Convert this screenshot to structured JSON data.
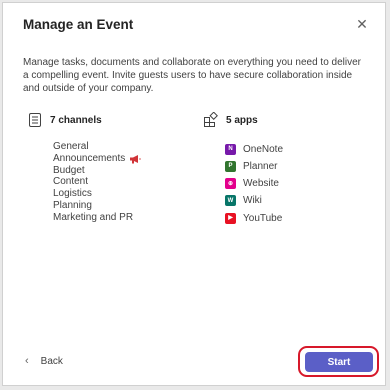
{
  "dialog": {
    "title": "Manage an Event",
    "close_icon": "close-icon",
    "description": "Manage tasks, documents and collaborate on everything you need to deliver a compelling event. Invite guests users to have secure collaboration inside and outside of your company."
  },
  "channels": {
    "heading": "7 channels",
    "icon": "channels-icon",
    "items": [
      "General",
      "Announcements",
      "Budget",
      "Content",
      "Logistics",
      "Planning",
      "Marketing and PR"
    ],
    "announcement_icon": "megaphone-icon"
  },
  "apps": {
    "heading": "5 apps",
    "icon": "apps-icon",
    "items": [
      {
        "label": "OneNote",
        "icon": "onenote-icon",
        "color": "#7719aa"
      },
      {
        "label": "Planner",
        "icon": "planner-icon",
        "color": "#31752f"
      },
      {
        "label": "Website",
        "icon": "website-icon",
        "color": "#e3008c"
      },
      {
        "label": "Wiki",
        "icon": "wiki-icon",
        "color": "#077568"
      },
      {
        "label": "YouTube",
        "icon": "youtube-icon",
        "color": "#e81123"
      }
    ]
  },
  "footer": {
    "back_label": "Back",
    "start_label": "Start"
  },
  "colors": {
    "accent": "#5b5fc7",
    "highlight": "#d7182a"
  }
}
